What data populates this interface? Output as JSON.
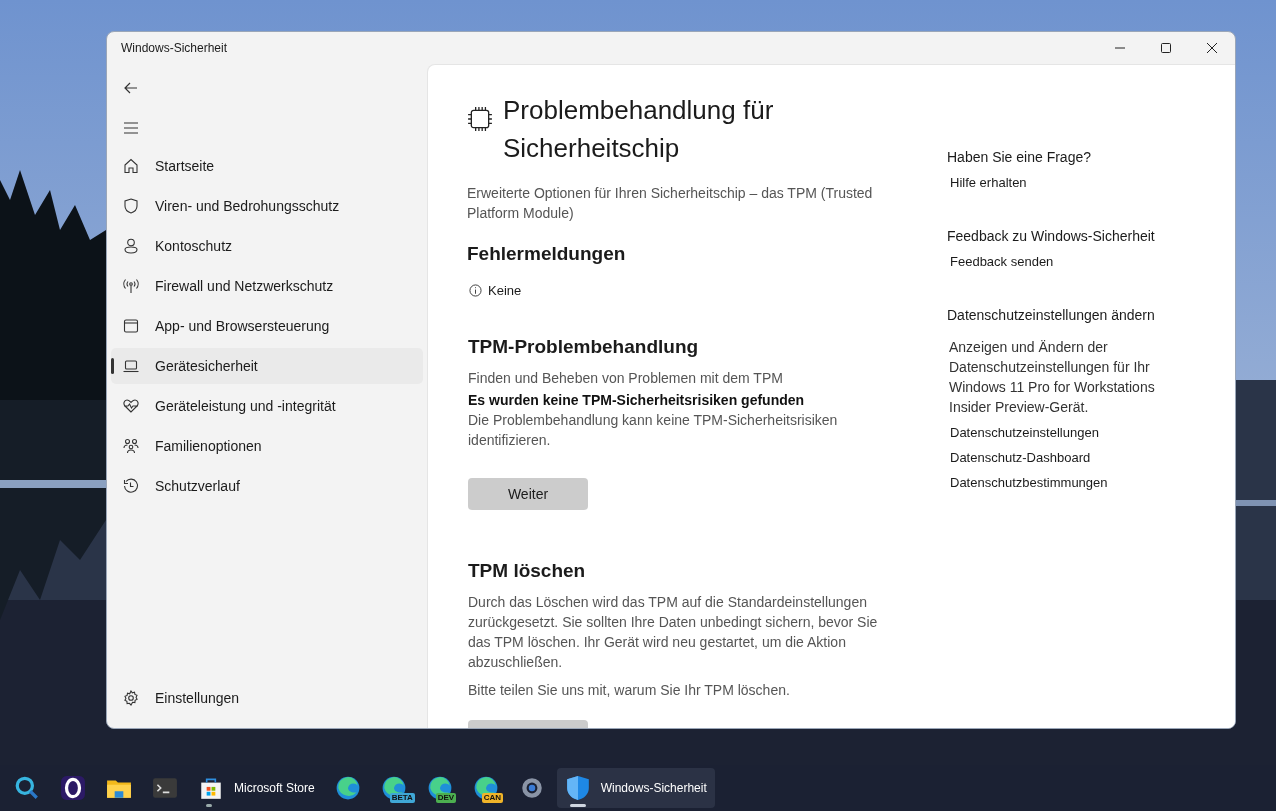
{
  "window": {
    "title": "Windows-Sicherheit"
  },
  "sidebar": {
    "items": [
      {
        "kind": "home",
        "label": "Startseite",
        "selected": false
      },
      {
        "kind": "shield",
        "label": "Viren- und Bedrohungsschutz",
        "selected": false
      },
      {
        "kind": "person",
        "label": "Kontoschutz",
        "selected": false
      },
      {
        "kind": "antenna",
        "label": "Firewall und Netzwerkschutz",
        "selected": false
      },
      {
        "kind": "window",
        "label": "App- und Browsersteuerung",
        "selected": false
      },
      {
        "kind": "laptop",
        "label": "Gerätesicherheit",
        "selected": true
      },
      {
        "kind": "heart",
        "label": "Geräteleistung und -integrität",
        "selected": false
      },
      {
        "kind": "family",
        "label": "Familienoptionen",
        "selected": false
      },
      {
        "kind": "history",
        "label": "Schutzverlauf",
        "selected": false
      }
    ],
    "settings": "Einstellungen"
  },
  "page": {
    "title": "Problembehandlung für Sicherheitschip",
    "description": "Erweiterte Optionen für Ihren Sicherheitschip – das TPM (Trusted Platform Module)",
    "errors": {
      "heading": "Fehlermeldungen",
      "value": "Keine"
    },
    "sections": [
      {
        "heading": "TPM-Problembehandlung",
        "lines": [
          {
            "kind": "plain",
            "text": "Finden und Beheben von Problemen mit dem TPM"
          },
          {
            "kind": "bold",
            "text": "Es wurden keine TPM-Sicherheitsrisiken gefunden"
          },
          {
            "kind": "plain",
            "text": "Die Problembehandlung kann keine TPM-Sicherheitsrisiken identifizieren."
          }
        ],
        "button": {
          "label": "Weiter"
        }
      },
      {
        "heading": "TPM löschen",
        "lines": [
          {
            "kind": "para",
            "text": "Durch das Löschen wird das TPM auf die Standardeinstellungen zurückgesetzt. Sie sollten Ihre Daten unbedingt sichern, bevor Sie das TPM löschen. Ihr Gerät wird neu gestartet, um die Aktion abzuschließen."
          },
          {
            "kind": "para",
            "text": "Bitte teilen Sie uns mit, warum Sie Ihr TPM löschen."
          }
        ],
        "button_cut": true
      }
    ]
  },
  "aside": [
    {
      "heading": "Haben Sie eine Frage?",
      "links": [
        "Hilfe erhalten"
      ]
    },
    {
      "heading": "Feedback zu Windows-Sicherheit",
      "links": [
        "Feedback senden"
      ]
    },
    {
      "heading": "Datenschutzeinstellungen ändern",
      "text": "Anzeigen und Ändern der Datenschutzeinstellungen für Ihr Windows 11 Pro for Workstations Insider Preview-Gerät.",
      "links": [
        "Datenschutzeinstellungen",
        "Datenschutz-Dashboard",
        "Datenschutzbestimmungen"
      ]
    }
  ],
  "taskbar": [
    {
      "kind": "search",
      "running": false,
      "selected": false
    },
    {
      "kind": "opera",
      "running": false,
      "selected": false
    },
    {
      "kind": "folder",
      "running": false,
      "selected": false
    },
    {
      "kind": "terminal",
      "running": false,
      "selected": false
    },
    {
      "kind": "store",
      "label": "Microsoft Store",
      "running": true,
      "selected": false
    },
    {
      "kind": "edge",
      "running": false,
      "selected": false
    },
    {
      "kind": "edge",
      "badge": "BETA",
      "color": "#3fa7d6",
      "running": false,
      "selected": false
    },
    {
      "kind": "edge",
      "badge": "DEV",
      "color": "#4caf50",
      "running": false,
      "selected": false
    },
    {
      "kind": "edge",
      "badge": "CAN",
      "color": "#f0b429",
      "running": false,
      "selected": false
    },
    {
      "kind": "gear",
      "running": false,
      "selected": false
    },
    {
      "kind": "shield",
      "label": "Windows-Sicherheit",
      "running": true,
      "selected": true
    }
  ]
}
